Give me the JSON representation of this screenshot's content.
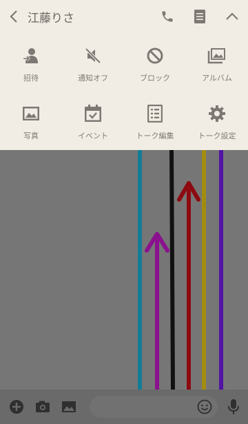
{
  "header": {
    "title": "江藤りさ",
    "icons": [
      "back-icon",
      "phone-icon",
      "notes-icon",
      "collapse-icon"
    ]
  },
  "menu": {
    "items": [
      {
        "label": "招待",
        "icon": "invite-icon"
      },
      {
        "label": "通知オフ",
        "icon": "mute-icon"
      },
      {
        "label": "ブロック",
        "icon": "block-icon"
      },
      {
        "label": "アルバム",
        "icon": "album-icon"
      },
      {
        "label": "写真",
        "icon": "photo-icon"
      },
      {
        "label": "イベント",
        "icon": "event-icon"
      },
      {
        "label": "トーク編集",
        "icon": "edit-talk-icon"
      },
      {
        "label": "トーク設定",
        "icon": "settings-icon"
      }
    ]
  },
  "colors": {
    "panel_bg": "#f1ede5",
    "chat_bg": "#767676",
    "bar_bg": "#6a6a6a",
    "icon_color": "#7d7873",
    "stripes": [
      "#137c97",
      "#8b118e",
      "#111111",
      "#8d0a10",
      "#a28d0e",
      "#5213a4"
    ]
  },
  "input_bar": {
    "icons": [
      "plus-icon",
      "camera-icon",
      "image-icon",
      "emoji-icon",
      "mic-icon"
    ],
    "message_placeholder": ""
  }
}
